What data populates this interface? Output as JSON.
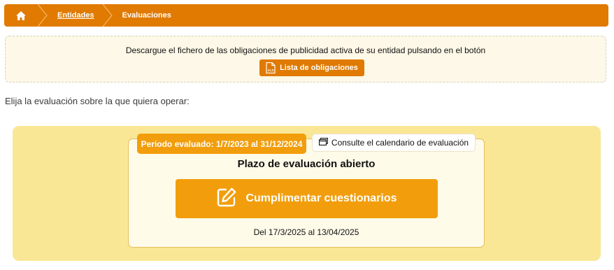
{
  "breadcrumb": {
    "items": [
      {
        "label": "Entidades"
      },
      {
        "label": "Evaluaciones"
      }
    ]
  },
  "notice": {
    "text": "Descargue el fichero de las obligaciones de publicidad activa de su entidad pulsando en el botón",
    "button_label": "Lista de obligaciones",
    "button_icon_text": "XLS"
  },
  "prompt": "Elija la evaluación sobre la que quiera operar:",
  "evaluation": {
    "period_label": "Periodo evaluado: 1/7/2023 al 31/12/2024",
    "calendar_button": "Consulte el calendario de evaluación",
    "deadline_title": "Plazo de evaluación abierto",
    "fill_button": "Cumplimentar cuestionarios",
    "date_range": "Del 17/3/2025 al 13/04/2025"
  },
  "colors": {
    "breadcrumb_bg": "#e07a00",
    "accent_orange": "#f29e0c",
    "panel_yellow": "#fae796",
    "card_bg": "#fffbe9",
    "notice_bg": "#fdf8e7"
  }
}
